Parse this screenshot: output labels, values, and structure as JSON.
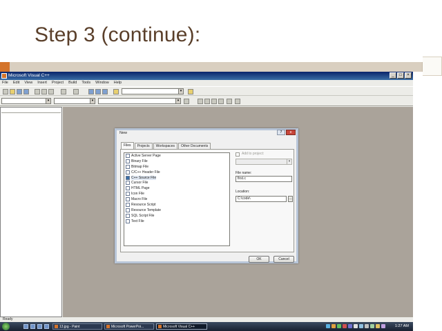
{
  "slide": {
    "title": "Step 3 (continue):"
  },
  "window": {
    "title": "Microsoft Visual C++",
    "menu": [
      "File",
      "Edit",
      "View",
      "Insert",
      "Project",
      "Build",
      "Tools",
      "Window",
      "Help"
    ],
    "status": "Ready"
  },
  "dialog": {
    "title": "New",
    "tabs": [
      "Files",
      "Projects",
      "Workspaces",
      "Other Documents"
    ],
    "active_tab": 0,
    "files": [
      "Active Server Page",
      "Binary File",
      "Bitmap File",
      "C/C++ Header File",
      "C++ Source File",
      "Cursor File",
      "HTML Page",
      "Icon File",
      "Macro File",
      "Resource Script",
      "Resource Template",
      "SQL Script File",
      "Text File"
    ],
    "selected_file": 4,
    "add_to_project_label": "Add to project:",
    "file_name_label": "File name:",
    "file_name_value": "first.c",
    "location_label": "Location:",
    "location_value": "C:\\code\\",
    "browse_label": "...",
    "ok_label": "OK",
    "cancel_label": "Cancel",
    "help_label": "?",
    "close_label": "x"
  },
  "taskbar": {
    "buttons": [
      "13.jpg - Paint",
      "Microsoft PowerPoi...",
      "Microsoft Visual C++"
    ],
    "active_button": 2,
    "clock": "1:27 AM"
  },
  "colors": {
    "title_text": "#5a3f2a",
    "band": "#d9cfc0",
    "accent": "#d4742b",
    "workspace": "#aaa39a",
    "titlebar": "#0a246a"
  }
}
